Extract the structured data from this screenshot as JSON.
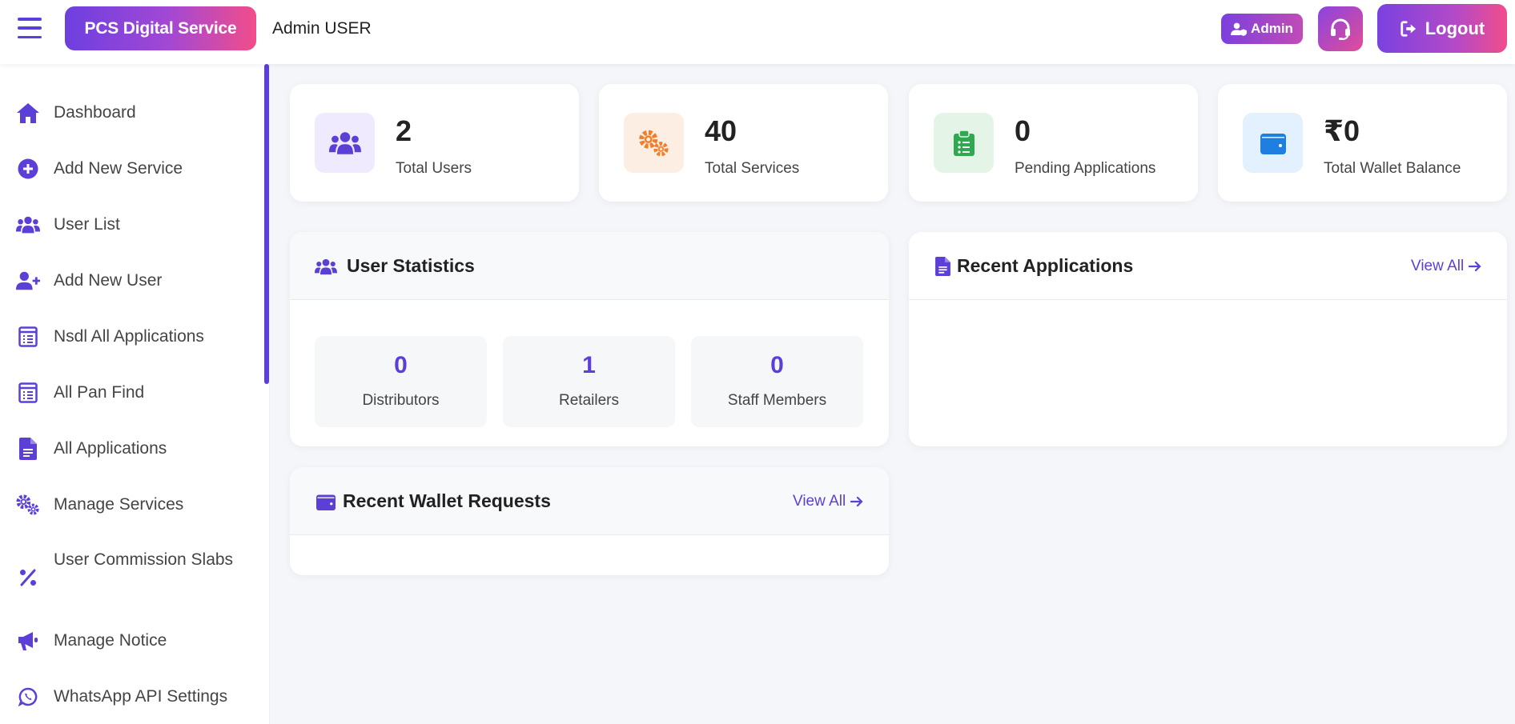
{
  "header": {
    "brand": "PCS Digital Service",
    "admin_name": "Admin USER",
    "admin_badge": "Admin",
    "logout_label": "Logout"
  },
  "sidebar": {
    "items": [
      {
        "label": "Dashboard",
        "icon": "home-icon"
      },
      {
        "label": "Add New Service",
        "icon": "plus-circle-icon"
      },
      {
        "label": "User List",
        "icon": "users-icon"
      },
      {
        "label": "Add New User",
        "icon": "user-plus-icon"
      },
      {
        "label": "Nsdl All Applications",
        "icon": "list-alt-icon"
      },
      {
        "label": "All Pan Find",
        "icon": "list-alt-icon"
      },
      {
        "label": "All Applications",
        "icon": "file-icon"
      },
      {
        "label": "Manage Services",
        "icon": "cogs-icon"
      },
      {
        "label": "User Commission Slabs",
        "icon": "percent-icon"
      },
      {
        "label": "Manage Notice",
        "icon": "megaphone-icon"
      },
      {
        "label": "WhatsApp API Settings",
        "icon": "whatsapp-icon"
      }
    ]
  },
  "stats": [
    {
      "value": "2",
      "label": "Total Users",
      "icon": "users-icon"
    },
    {
      "value": "40",
      "label": "Total Services",
      "icon": "cogs-icon"
    },
    {
      "value": "0",
      "label": "Pending Applications",
      "icon": "clipboard-icon"
    },
    {
      "value": "₹0",
      "label": "Total Wallet Balance",
      "icon": "wallet-icon"
    }
  ],
  "user_statistics": {
    "title": "User Statistics",
    "items": [
      {
        "value": "0",
        "label": "Distributors"
      },
      {
        "value": "1",
        "label": "Retailers"
      },
      {
        "value": "0",
        "label": "Staff Members"
      }
    ]
  },
  "recent_applications": {
    "title": "Recent Applications",
    "view_all": "View All"
  },
  "recent_wallet": {
    "title": "Recent Wallet Requests",
    "view_all": "View All"
  },
  "colors": {
    "accent": "#5b3fd6",
    "pink": "#f24d8a",
    "orange": "#f07f2c",
    "green": "#2fa84f",
    "blue": "#1f7fe0"
  }
}
